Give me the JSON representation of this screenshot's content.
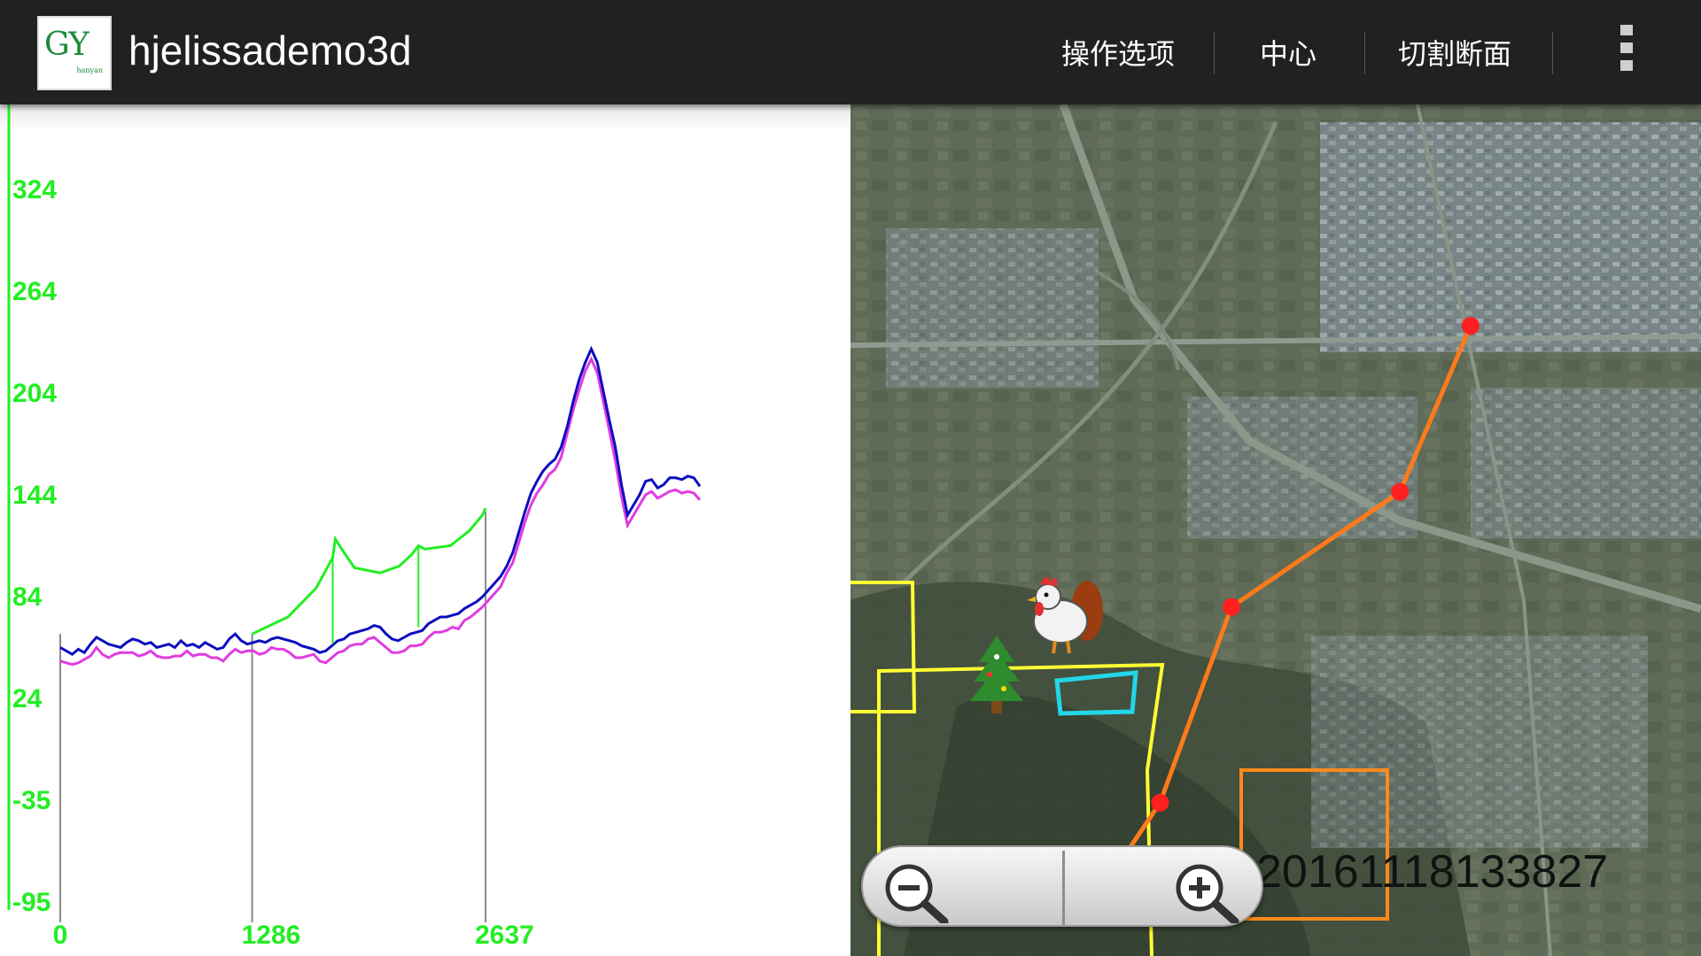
{
  "app": {
    "logo_text": "GY",
    "logo_subtext": "hanyan",
    "title": "hjelissademo3d"
  },
  "actions": [
    {
      "label": "操作选项"
    },
    {
      "label": "中心"
    },
    {
      "label": "切割断面"
    }
  ],
  "profile": {
    "y_ticks": [
      "324",
      "264",
      "204",
      "144",
      "84",
      "24",
      "-35",
      "-95"
    ],
    "x_ticks": [
      "0",
      "1286",
      "2637"
    ],
    "colors": {
      "axis": "#22ee22",
      "series_a": "#0d0dbf",
      "series_b": "#e03ce0",
      "overlay": "#22ee22",
      "markers": "#888888"
    },
    "series_a": [
      54,
      52,
      50,
      53,
      51,
      56,
      60,
      58,
      56,
      55,
      54,
      57,
      59,
      58,
      56,
      57,
      54,
      55,
      56,
      54,
      58,
      55,
      56,
      54,
      57,
      55,
      53,
      54,
      59,
      62,
      58,
      56,
      57,
      58,
      57,
      59,
      60,
      59,
      58,
      57,
      55,
      54,
      53,
      51,
      52,
      55,
      58,
      59,
      62,
      63,
      64,
      65,
      67,
      66,
      62,
      59,
      58,
      60,
      62,
      63,
      64,
      68,
      70,
      72,
      72,
      73,
      74,
      77,
      79,
      81,
      84,
      88,
      92,
      96,
      102,
      110,
      122,
      134,
      145,
      152,
      158,
      162,
      165,
      172,
      184,
      199,
      212,
      222,
      230,
      222,
      205,
      188,
      172,
      150,
      132,
      138,
      144,
      152,
      153,
      148,
      150,
      154,
      154,
      153,
      155,
      154,
      149
    ],
    "series_b": [
      46,
      45,
      44,
      45,
      47,
      49,
      54,
      50,
      48,
      50,
      51,
      51,
      51,
      49,
      50,
      52,
      49,
      48,
      48,
      49,
      49,
      52,
      49,
      50,
      50,
      48,
      48,
      46,
      50,
      53,
      51,
      52,
      52,
      50,
      51,
      54,
      53,
      53,
      51,
      48,
      48,
      49,
      50,
      46,
      45,
      48,
      51,
      52,
      55,
      56,
      56,
      59,
      60,
      57,
      54,
      51,
      51,
      52,
      55,
      55,
      56,
      60,
      63,
      63,
      64,
      66,
      65,
      70,
      72,
      75,
      78,
      82,
      86,
      90,
      98,
      104,
      116,
      128,
      138,
      145,
      150,
      156,
      159,
      166,
      180,
      194,
      206,
      217,
      224,
      216,
      199,
      182,
      164,
      143,
      126,
      132,
      138,
      144,
      146,
      142,
      144,
      146,
      147,
      145,
      146,
      145,
      141
    ],
    "overlay_polyline": [
      [
        0.3,
        62
      ],
      [
        0.356,
        72
      ],
      [
        0.4,
        89
      ],
      [
        0.426,
        107
      ],
      [
        0.43,
        118
      ],
      [
        0.44,
        112
      ],
      [
        0.46,
        101
      ],
      [
        0.5,
        98
      ],
      [
        0.53,
        102
      ],
      [
        0.55,
        109
      ],
      [
        0.56,
        114
      ],
      [
        0.57,
        112
      ],
      [
        0.61,
        114
      ],
      [
        0.64,
        123
      ],
      [
        0.66,
        132
      ],
      [
        0.665,
        136
      ]
    ],
    "overlay_stems": [
      0.426,
      0.56
    ],
    "marker_stems": [
      0,
      0.3,
      0.665
    ]
  },
  "map": {
    "timestamp": "20161118133827",
    "route_points": [
      [
        0.729,
        0.26
      ],
      [
        0.646,
        0.455
      ],
      [
        0.448,
        0.59
      ],
      [
        0.364,
        0.82
      ],
      [
        0.29,
        0.93
      ]
    ],
    "route_color": "#ff7a1a",
    "node_color": "#ff2020",
    "yellow_color": "#ffff33",
    "cyan_color": "#22d7e8",
    "orange_box_color": "#ff8a1a"
  },
  "zoom": {
    "out_icon": "zoom-out-icon",
    "in_icon": "zoom-in-icon"
  }
}
